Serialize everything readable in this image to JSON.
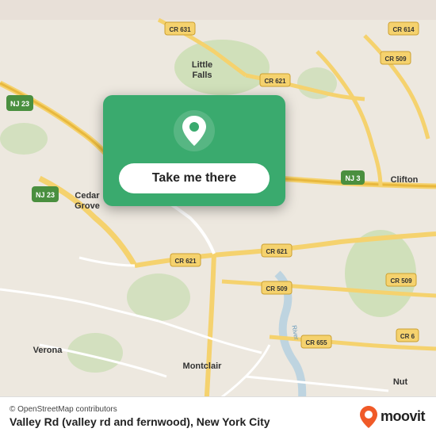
{
  "map": {
    "alt": "Map of New Jersey area showing Valley Rd area",
    "background_color": "#e8ded4"
  },
  "card": {
    "button_label": "Take me there",
    "pin_color": "#ffffff"
  },
  "bottom_bar": {
    "osm_credit": "© OpenStreetMap contributors",
    "location_name": "Valley Rd (valley rd and fernwood), New York City",
    "moovit_label": "moovit"
  }
}
